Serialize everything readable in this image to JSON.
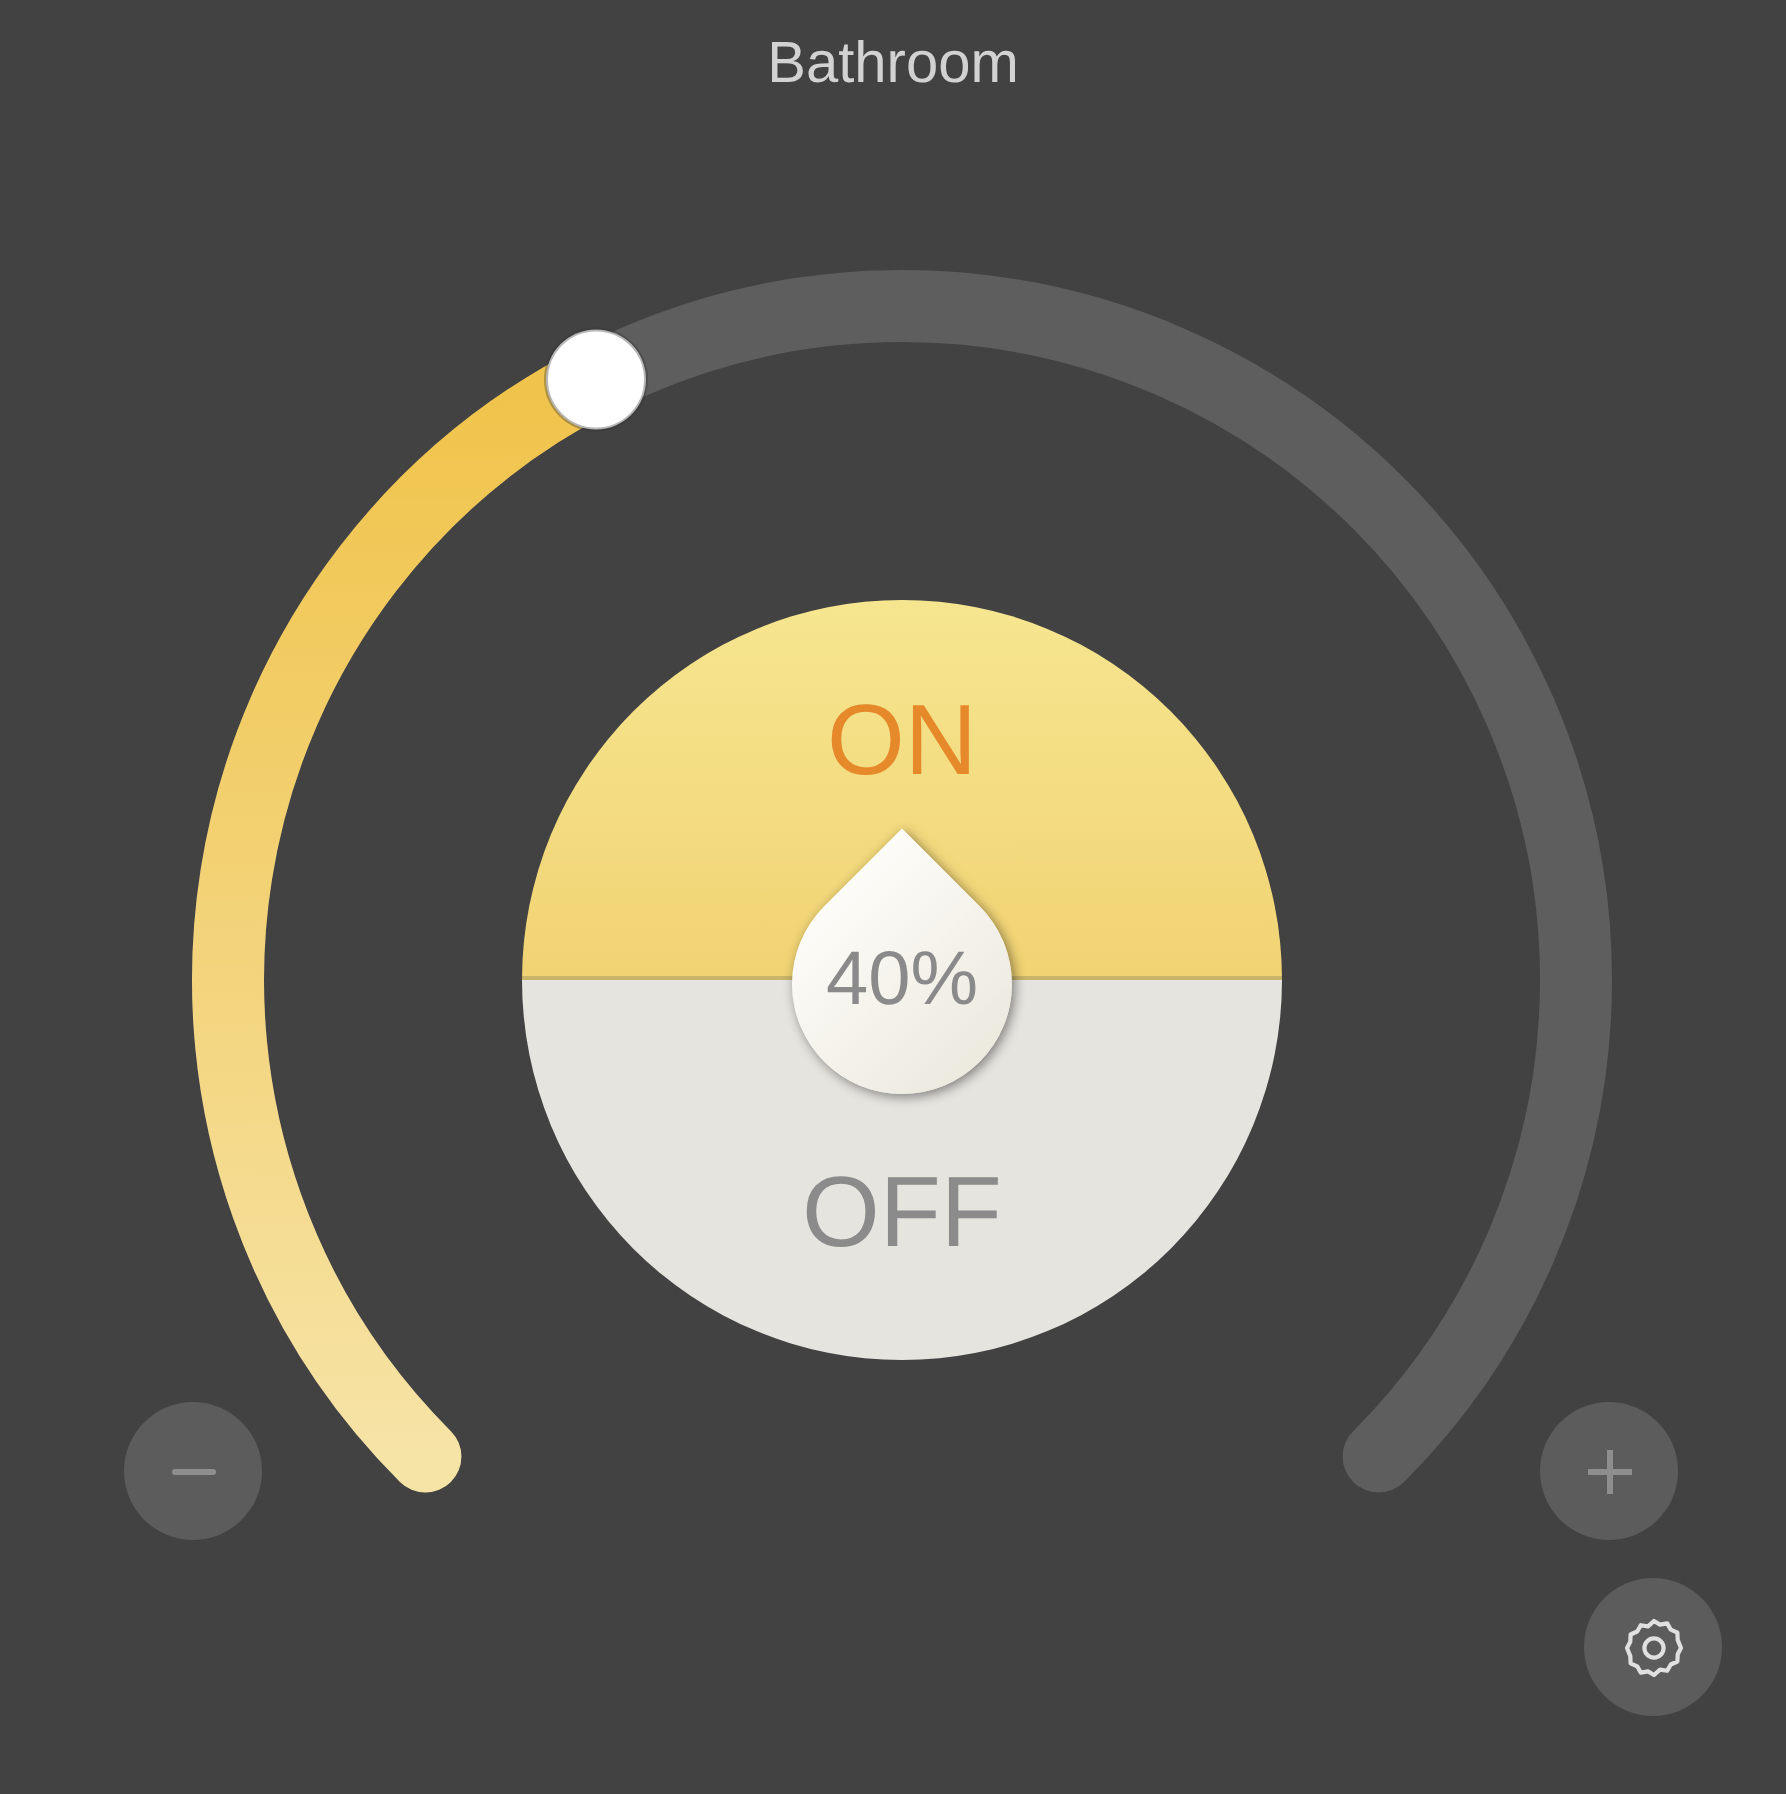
{
  "title": "Bathroom",
  "dial": {
    "reading": "40%"
  },
  "power": {
    "on": true,
    "on_label": "ON",
    "off_label": "OFF"
  },
  "buttons": [
    {
      "kind": "minus"
    },
    {
      "kind": "plus"
    },
    {
      "kind": "settings"
    }
  ]
}
